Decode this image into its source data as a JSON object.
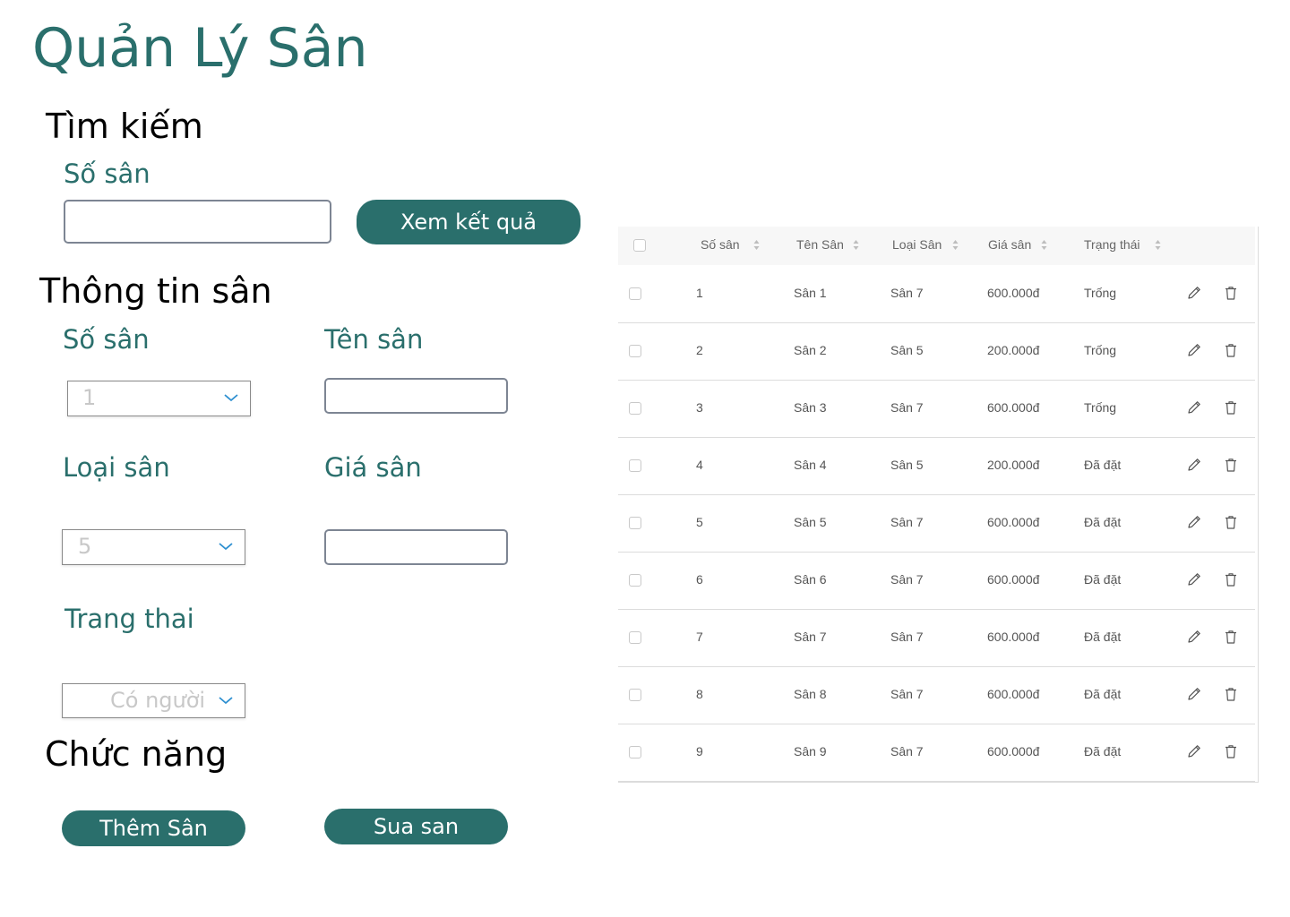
{
  "page_title": "Quản Lý Sân",
  "search": {
    "section_title": "Tìm kiếm",
    "field_label": "Số sân",
    "input_value": "",
    "button_label": "Xem kết quả"
  },
  "info": {
    "section_title": "Thông tin sân",
    "so_san": {
      "label": "Số sân",
      "value": "1"
    },
    "ten_san": {
      "label": "Tên sân",
      "value": ""
    },
    "loai_san": {
      "label": "Loại sân",
      "value": "5"
    },
    "gia_san": {
      "label": "Giá sân",
      "value": ""
    },
    "trang_thai": {
      "label": "Trang thai",
      "value": "Có người"
    }
  },
  "functions": {
    "section_title": "Chức năng",
    "add_button": "Thêm Sân",
    "edit_button": "Sua san"
  },
  "table": {
    "columns": [
      "Số sân",
      "Tên Sân",
      "Loại Sân",
      "Giá sân",
      "Trạng thái"
    ],
    "rows": [
      {
        "so": "1",
        "ten": "Sân 1",
        "loai": "Sân 7",
        "gia": "600.000đ",
        "trang_thai": "Trống"
      },
      {
        "so": "2",
        "ten": "Sân 2",
        "loai": "Sân 5",
        "gia": "200.000đ",
        "trang_thai": "Trống"
      },
      {
        "so": "3",
        "ten": "Sân 3",
        "loai": "Sân 7",
        "gia": "600.000đ",
        "trang_thai": "Trống"
      },
      {
        "so": "4",
        "ten": "Sân 4",
        "loai": "Sân 5",
        "gia": "200.000đ",
        "trang_thai": "Đã đặt"
      },
      {
        "so": "5",
        "ten": "Sân 5",
        "loai": "Sân 7",
        "gia": "600.000đ",
        "trang_thai": "Đã đặt"
      },
      {
        "so": "6",
        "ten": "Sân 6",
        "loai": "Sân 7",
        "gia": "600.000đ",
        "trang_thai": "Đã đặt"
      },
      {
        "so": "7",
        "ten": "Sân 7",
        "loai": "Sân 7",
        "gia": "600.000đ",
        "trang_thai": "Đã đặt"
      },
      {
        "so": "8",
        "ten": "Sân 8",
        "loai": "Sân 7",
        "gia": "600.000đ",
        "trang_thai": "Đã đặt"
      },
      {
        "so": "9",
        "ten": "Sân 9",
        "loai": "Sân 7",
        "gia": "600.000đ",
        "trang_thai": "Đã đặt"
      }
    ],
    "row_icons": [
      "edit-icon",
      "trash-icon"
    ]
  },
  "colors": {
    "accent": "#2a6f6c",
    "header_bg": "#f7f7f7",
    "border": "#dcdcdc"
  }
}
